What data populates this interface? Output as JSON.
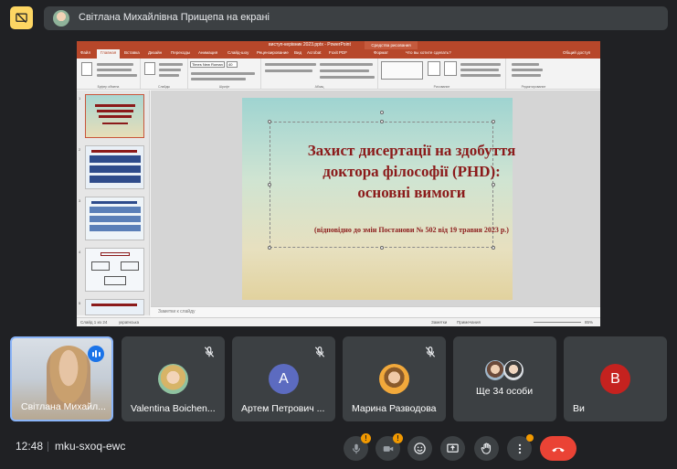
{
  "header": {
    "presenter_text": "Світлана Михайлівна Прищепа на екрані"
  },
  "ppt": {
    "title": "виступ-керівник 2023.pptx - PowerPoint",
    "context_tab": "Средства рисования",
    "tabs": [
      "Файл",
      "Главная",
      "Вставка",
      "Дизайн",
      "Переходы",
      "Анимация",
      "Слайд-шоу",
      "Рецензирование",
      "Вид",
      "Acrobat",
      "Foxit PDF",
      "Формат"
    ],
    "help_text": "Что вы хотите сделать?",
    "share_text": "Общий доступ",
    "ribbon_groups": [
      "Буфер обмена",
      "Слайды",
      "Шрифт",
      "Абзац",
      "Рисование",
      "Редактирование"
    ],
    "font_name": "Times New Roman",
    "font_size": "40",
    "slide_title": "Захист дисертації на здобуття доктора філософії (PHD): основні вимоги",
    "slide_subtitle": "(відповідно до змін Постанови № 502 від 19 травня 2023 р.)",
    "thumb_numbers": [
      "1",
      "2",
      "3",
      "4",
      "5"
    ],
    "notes_placeholder": "Заметки к слайду",
    "status_left": "Слайд 1 из 24",
    "status_lang": "українська",
    "status_notes": "Заметки",
    "status_comments": "Примечания",
    "zoom": "85%"
  },
  "tiles": [
    {
      "name": "Світлана Михайл...",
      "type": "video",
      "speaking": true
    },
    {
      "name": "Valentina Boichen...",
      "type": "avatar",
      "muted": true
    },
    {
      "name": "Артем Петрович ...",
      "type": "letter",
      "letter": "А",
      "color": "#5c6bc0",
      "muted": true
    },
    {
      "name": "Марина Разводова",
      "type": "avatar",
      "muted": true
    },
    {
      "name": "Ще 34 особи",
      "type": "group"
    },
    {
      "name": "Ви",
      "type": "letter",
      "letter": "В",
      "color": "#c5221f"
    }
  ],
  "bottom": {
    "time": "12:48",
    "meeting_code": "mku-sxoq-ewc",
    "mic_badge": "!",
    "cam_badge": "!"
  }
}
